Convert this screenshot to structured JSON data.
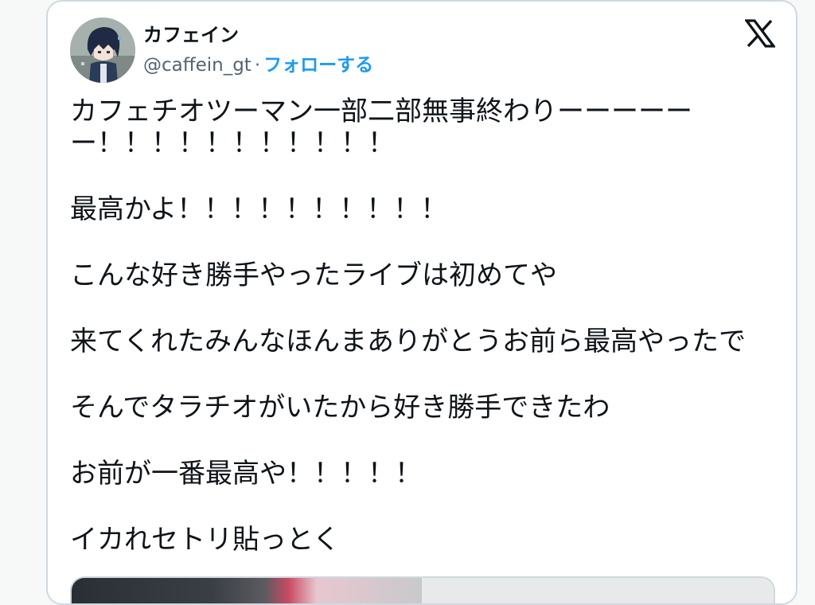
{
  "tweet": {
    "display_name": "カフェイン",
    "handle": "@caffein_gt",
    "separator": "·",
    "follow_label": "フォローする",
    "lines": [
      "カフェチオツーマン一部二部無事終わりーーーーーー！！！！！！！！！！！",
      "最高かよ！！！！！！！！！！",
      "こんな好き勝手やったライブは初めてや",
      "来てくれたみんなほんまありがとうお前ら最高やったで",
      "そんでタラチオがいたから好き勝手できたわ",
      "お前が一番最高や！！！！！",
      "イカれセトリ貼っとく"
    ]
  },
  "icons": {
    "brand": "x-logo-icon",
    "avatar": "avatar-icon"
  },
  "colors": {
    "link": "#1d9bf0",
    "text": "#0f1419",
    "secondary": "#536471",
    "border": "#cfd9de"
  }
}
